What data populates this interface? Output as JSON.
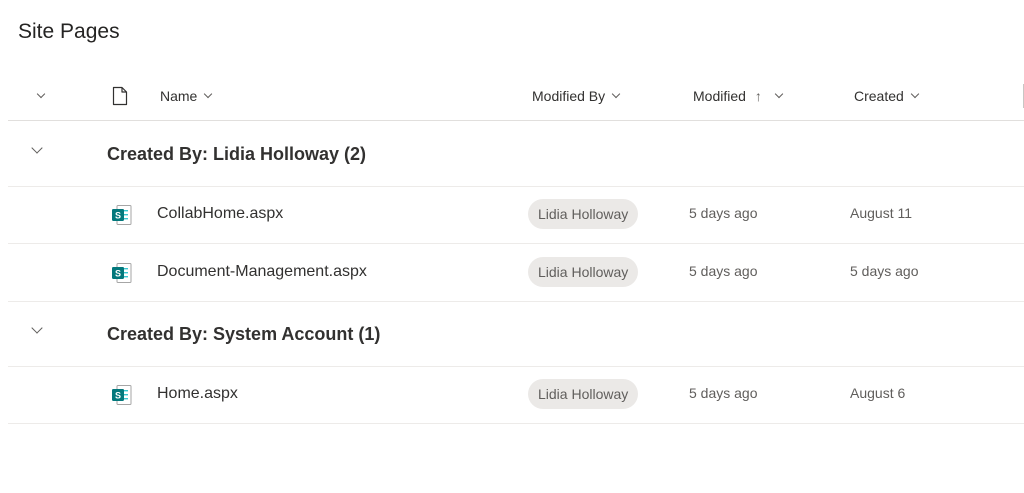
{
  "page": {
    "title": "Site Pages"
  },
  "columns": {
    "name": "Name",
    "modified_by": "Modified By",
    "modified": "Modified",
    "created": "Created"
  },
  "groups": [
    {
      "title": "Created By: Lidia Holloway (2)",
      "rows": [
        {
          "name": "CollabHome.aspx",
          "modified_by": "Lidia Holloway",
          "modified": "5 days ago",
          "created": "August 11"
        },
        {
          "name": "Document-Management.aspx",
          "modified_by": "Lidia Holloway",
          "modified": "5 days ago",
          "created": "5 days ago"
        }
      ]
    },
    {
      "title": "Created By: System Account (1)",
      "rows": [
        {
          "name": "Home.aspx",
          "modified_by": "Lidia Holloway",
          "modified": "5 days ago",
          "created": "August 6"
        }
      ]
    }
  ],
  "icons": {
    "file_type": "sharepoint-page-icon",
    "header_file": "document-icon"
  },
  "colors": {
    "sharepoint_teal": "#03787c",
    "person_pill_bg": "#ebe9e7"
  }
}
